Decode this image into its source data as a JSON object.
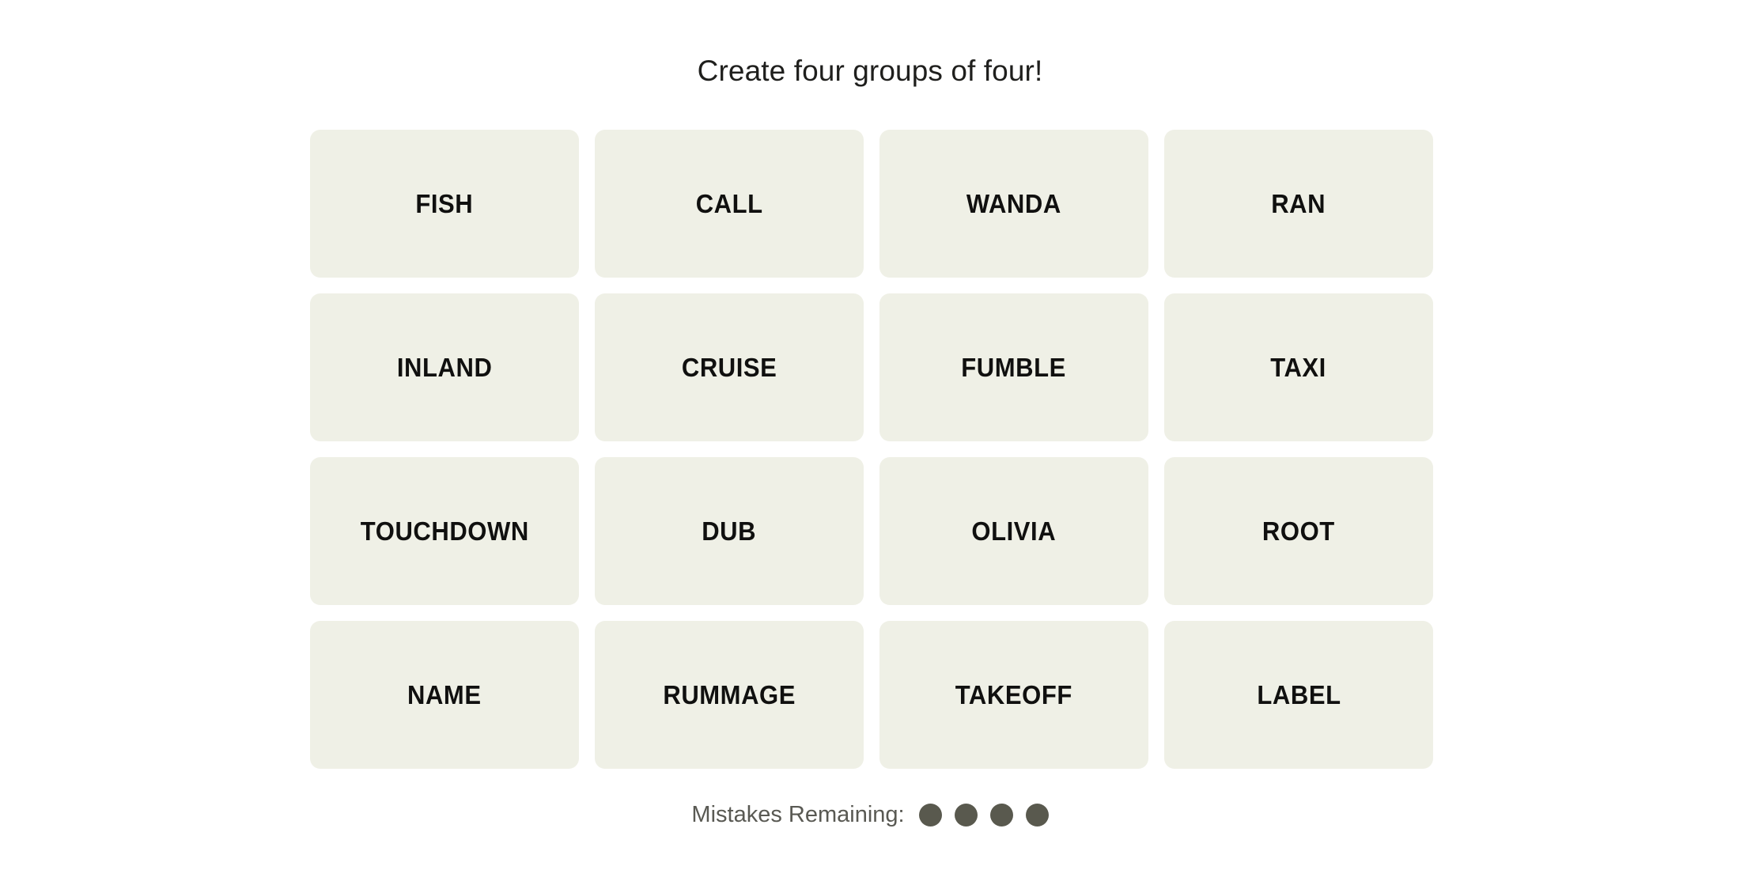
{
  "header": {
    "instruction": "Create four groups of four!"
  },
  "board": {
    "columns": 4,
    "rows": 4,
    "tile_background": "#EFF0E6",
    "tile_text_color": "#10100F",
    "tiles": [
      {
        "label": "FISH"
      },
      {
        "label": "CALL"
      },
      {
        "label": "WANDA"
      },
      {
        "label": "RAN"
      },
      {
        "label": "INLAND"
      },
      {
        "label": "CRUISE"
      },
      {
        "label": "FUMBLE"
      },
      {
        "label": "TAXI"
      },
      {
        "label": "TOUCHDOWN"
      },
      {
        "label": "DUB"
      },
      {
        "label": "OLIVIA"
      },
      {
        "label": "ROOT"
      },
      {
        "label": "NAME"
      },
      {
        "label": "RUMMAGE"
      },
      {
        "label": "TAKEOFF"
      },
      {
        "label": "LABEL"
      }
    ]
  },
  "footer": {
    "mistakes_label": "Mistakes Remaining:",
    "mistakes_remaining": 4,
    "dot_color": "#59594E",
    "label_color": "#595953",
    "dots": [
      {
        "state": "remaining"
      },
      {
        "state": "remaining"
      },
      {
        "state": "remaining"
      },
      {
        "state": "remaining"
      }
    ]
  },
  "page": {
    "background": "#FFFFFF"
  }
}
